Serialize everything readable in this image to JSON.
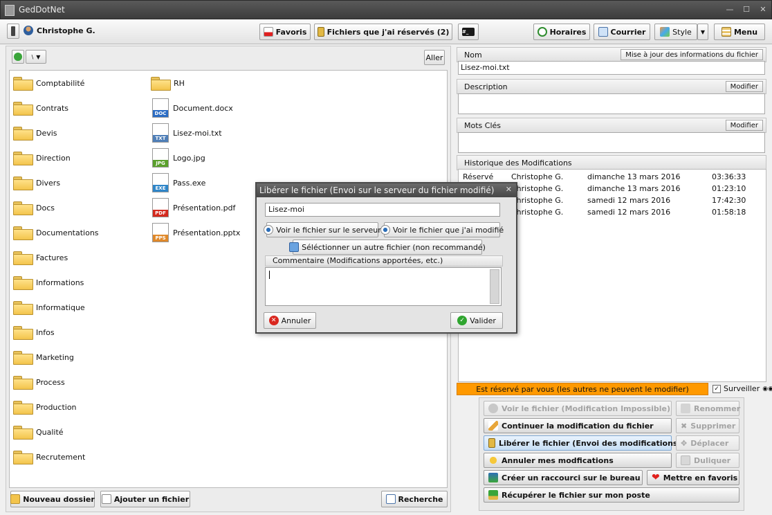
{
  "app": {
    "title": "GedDotNet"
  },
  "toolbar": {
    "user": "Christophe G.",
    "favoris": "Favoris",
    "reserved_files": "Fichiers que j'ai réservés (2)",
    "horaires": "Horaires",
    "courrier": "Courrier",
    "style": "Style",
    "menu": "Menu"
  },
  "left": {
    "go_label": "Aller",
    "folders_col1": [
      "Comptabilité",
      "Contrats",
      "Devis",
      "Direction",
      "Divers",
      "Docs",
      "Documentations",
      "Factures",
      "Informations",
      "Informatique",
      "Infos",
      "Marketing",
      "Process",
      "Production",
      "Qualité",
      "Recrutement"
    ],
    "col2": [
      {
        "name": "RH",
        "kind": "folder"
      },
      {
        "name": "Document.docx",
        "kind": "DOC",
        "color": "#2b6cc4"
      },
      {
        "name": "Lisez-moi.txt",
        "kind": "TXT",
        "color": "#4f7fb8"
      },
      {
        "name": "Logo.jpg",
        "kind": "JPG",
        "color": "#5aa02c"
      },
      {
        "name": "Pass.exe",
        "kind": "EXE",
        "color": "#2f86c9"
      },
      {
        "name": "Présentation.pdf",
        "kind": "PDF",
        "color": "#d42a1e"
      },
      {
        "name": "Présentation.pptx",
        "kind": "PPS",
        "color": "#e0892a"
      }
    ],
    "new_folder": "Nouveau dossier",
    "add_file": "Ajouter un fichier",
    "search": "Recherche"
  },
  "right": {
    "name_label": "Nom",
    "update_btn": "Mise à jour des informations du fichier",
    "name_value": "Lisez-moi.txt",
    "description_label": "Description",
    "modify": "Modifier",
    "keywords_label": "Mots Clés",
    "history_label": "Historique des Modifications",
    "history": [
      {
        "action": "Réservé",
        "user": "Christophe G.",
        "date": "dimanche 13 mars 2016",
        "time": "03:36:33"
      },
      {
        "action": "",
        "user": "Christophe G.",
        "date": "dimanche 13 mars 2016",
        "time": "01:23:10"
      },
      {
        "action": "",
        "user": "Christophe G.",
        "date": "samedi 12 mars 2016",
        "time": "17:42:30"
      },
      {
        "action": "",
        "user": "Christophe G.",
        "date": "samedi 12 mars 2016",
        "time": "01:58:18"
      }
    ],
    "reserved_msg": "Est réservé par vous (les autres ne peuvent le modifier)",
    "surveiller": "Surveiller",
    "actions": {
      "view_file": "Voir le fichier (Modification Impossible)",
      "rename": "Renommer",
      "continue_edit": "Continuer la modification du fichier",
      "delete": "Supprimer",
      "release": "Libérer le fichier (Envoi des modifications)",
      "move": "Déplacer",
      "cancel_edits": "Annuler mes modfications",
      "duplicate": "Duliquer",
      "shortcut": "Créer un raccourci sur le bureau",
      "favorite": "Mettre en favoris",
      "download": "Récupérer le fichier sur mon poste"
    }
  },
  "dialog": {
    "title": "Libérer le fichier (Envoi sur le serveur du fichier modifié)",
    "name_value": "Lisez-moi",
    "view_server": "Voir le fichier sur le serveur",
    "view_modified": "Voir le fichier que j'ai modifié",
    "select_other": "Séléctionner un autre fichier (non recommandé)",
    "comment_label": "Commentaire (Modifications apportées, etc.)",
    "cancel": "Annuler",
    "validate": "Valider"
  }
}
